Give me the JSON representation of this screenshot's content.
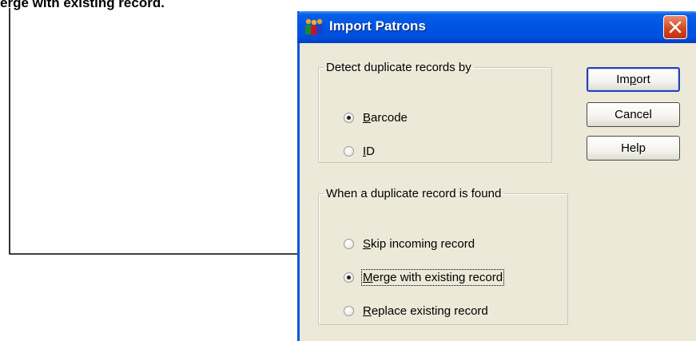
{
  "caption": {
    "text": "erge with existing record",
    "suffix": "."
  },
  "window": {
    "title": "Import Patrons",
    "icon": "patrons-people-icon",
    "close_icon": "close-icon"
  },
  "groups": {
    "detect": {
      "legend": "Detect duplicate records by",
      "options": [
        {
          "label": "Barcode",
          "accel": "B",
          "rest": "arcode",
          "checked": true
        },
        {
          "label": "ID",
          "accel": "I",
          "rest": "D",
          "checked": false
        }
      ]
    },
    "duplicate": {
      "legend": "When a duplicate record is found",
      "options": [
        {
          "label": "Skip incoming record",
          "accel": "S",
          "rest": "kip incoming record",
          "checked": false
        },
        {
          "label": "Merge with existing record",
          "accel": "M",
          "rest": "erge with existing record",
          "checked": true
        },
        {
          "label": "Replace existing record",
          "accel": "R",
          "rest": "eplace existing record",
          "checked": false
        }
      ]
    }
  },
  "buttons": {
    "import": {
      "pre": "Im",
      "accel": "p",
      "post": "ort"
    },
    "cancel": "Cancel",
    "help": "Help"
  },
  "colors": {
    "title_blue": "#0054e3",
    "close_red": "#d0451e",
    "dialog_bg": "#ece9d8"
  }
}
